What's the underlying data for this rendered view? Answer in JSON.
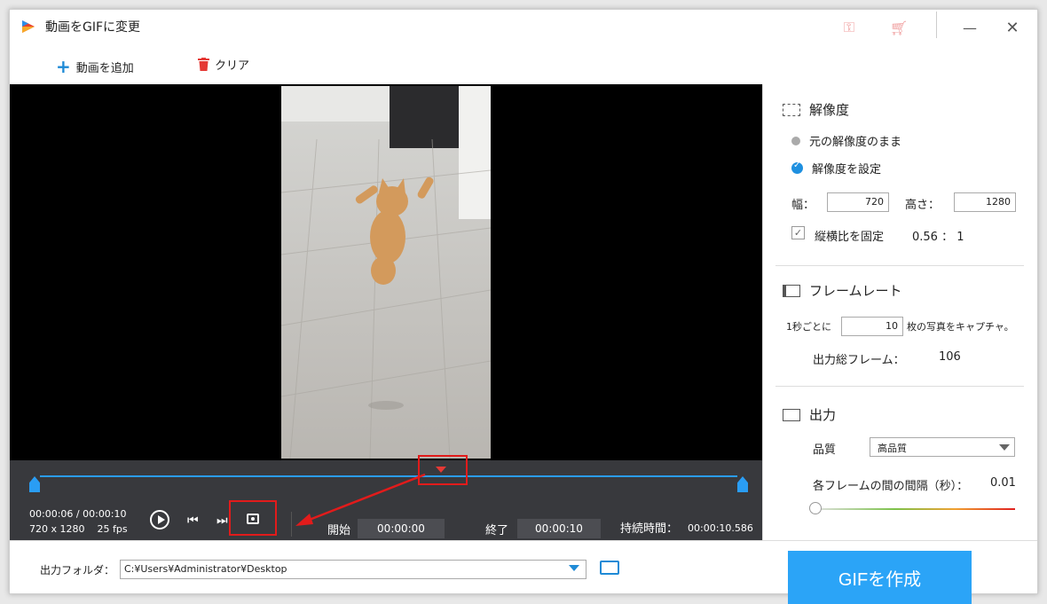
{
  "window": {
    "title": "動画をGIFに変更"
  },
  "toolbar": {
    "add_video": "動画を追加",
    "clear": "クリア"
  },
  "player": {
    "current_time": "00:00:06",
    "separator": " / ",
    "total_time": "00:00:10",
    "resolution": "720 x 1280",
    "fps": "25 fps",
    "start_label": "開始",
    "start_value": "00:00:00",
    "end_label": "終了",
    "end_value": "00:00:10",
    "duration_label": "持続時間：",
    "duration_value": "00:00:10.586"
  },
  "resolution_section": {
    "heading": "解像度",
    "option_original": "元の解像度のまま",
    "option_custom": "解像度を設定",
    "width_label": "幅：",
    "width_value": "720",
    "height_label": "高さ：",
    "height_value": "1280",
    "aspect_label": "縦横比を固定",
    "aspect_value": "0.56 ： 1"
  },
  "framerate_section": {
    "heading": "フレームレート",
    "per_sec_label": "1秒ごとに",
    "per_sec_value": "10",
    "capture_label": "枚の写真をキャプチャ。",
    "total_label": "出力総フレーム：",
    "total_value": "106"
  },
  "output_section": {
    "heading": "出力",
    "quality_label": "品質",
    "quality_value": "高品質",
    "interval_label": "各フレームの間の間隔（秒）：",
    "interval_value": "0.01"
  },
  "bottom": {
    "output_folder_label": "出力フォルダ：",
    "output_folder_path": "C:¥Users¥Administrator¥Desktop",
    "make_gif": "GIFを作成"
  },
  "colors": {
    "accent": "#2ba4f7",
    "highlight": "#e21b1b",
    "panel": "#38393d"
  },
  "icons": [
    "app-logo-icon",
    "key-icon",
    "cart-icon",
    "minimize-icon",
    "close-icon",
    "plus-icon",
    "trash-icon",
    "play-icon",
    "prev-frame-icon",
    "next-frame-icon",
    "snapshot-icon",
    "folder-icon"
  ]
}
